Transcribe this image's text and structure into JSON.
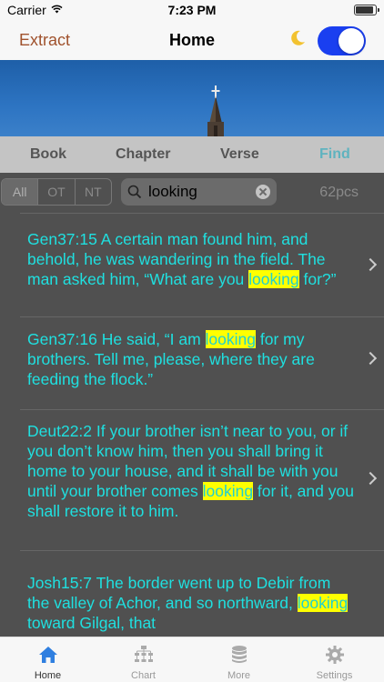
{
  "status": {
    "carrier": "Carrier",
    "time": "7:23 PM"
  },
  "nav": {
    "left_label": "Extract",
    "title": "Home",
    "theme_toggle_on": true
  },
  "tabs": [
    {
      "label": "Book"
    },
    {
      "label": "Chapter"
    },
    {
      "label": "Verse"
    },
    {
      "label": "Find",
      "active": true
    }
  ],
  "filter": {
    "segments": [
      {
        "label": "All",
        "selected": true
      },
      {
        "label": "OT"
      },
      {
        "label": "NT"
      }
    ],
    "search_value": "looking",
    "count": "62pcs"
  },
  "results": [
    {
      "before": "Gen37:15 A certain man found him, and behold, he was wandering in the field. The man asked him, “What are you ",
      "match": "looking",
      "after": " for?”"
    },
    {
      "before": "Gen37:16 He said, “I am ",
      "match": "looking",
      "after": " for my brothers. Tell me, please, where they are feeding the flock.”"
    },
    {
      "before": "Deut22:2 If your brother isn’t near to you, or if you don’t know him, then you shall bring it home to your house, and it shall be with you until your brother comes ",
      "match": "looking",
      "after": " for it, and you shall restore it to him."
    },
    {
      "before": "Josh15:7 The border went up to Debir from the valley of Achor, and so northward, ",
      "match": "looking",
      "after": " toward Gilgal, that"
    }
  ],
  "tabbar": [
    {
      "label": "Home",
      "icon": "home-icon",
      "active": true
    },
    {
      "label": "Chart",
      "icon": "chart-icon"
    },
    {
      "label": "More",
      "icon": "database-icon"
    },
    {
      "label": "Settings",
      "icon": "gear-icon"
    }
  ],
  "colors": {
    "accent": "#1a3ff0",
    "result_text": "#1fe0e0",
    "highlight": "#ffff00",
    "find_tab": "#5fb3bf"
  }
}
